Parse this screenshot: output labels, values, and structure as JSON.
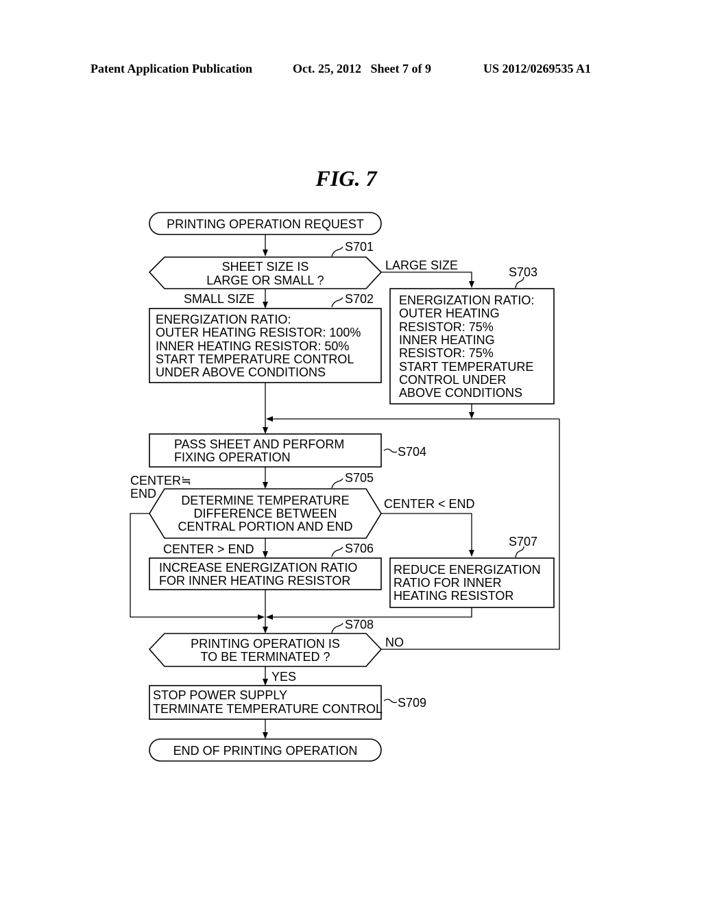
{
  "header": {
    "left": "Patent Application Publication",
    "middle": "Oct. 25, 2012   Sheet 7 of 9",
    "right": "US 2012/0269535 A1"
  },
  "figure_title": "FIG. 7",
  "nodes": {
    "start": {
      "lines": [
        "PRINTING OPERATION REQUEST"
      ]
    },
    "s701": {
      "step": "S701",
      "lines": [
        "SHEET SIZE IS",
        "LARGE OR SMALL ?"
      ]
    },
    "s702": {
      "step": "S702",
      "lines": [
        "ENERGIZATION RATIO:",
        "OUTER HEATING RESISTOR: 100%",
        "INNER HEATING RESISTOR: 50%",
        "START TEMPERATURE CONTROL",
        "UNDER ABOVE CONDITIONS"
      ]
    },
    "s703": {
      "step": "S703",
      "lines": [
        "ENERGIZATION RATIO:",
        "OUTER HEATING",
        "RESISTOR: 75%",
        "INNER HEATING",
        "RESISTOR: 75%",
        "START TEMPERATURE",
        "CONTROL UNDER",
        "ABOVE CONDITIONS"
      ]
    },
    "s704": {
      "step": "S704",
      "lines": [
        "PASS SHEET AND PERFORM",
        "FIXING OPERATION"
      ]
    },
    "s705": {
      "step": "S705",
      "lines": [
        "DETERMINE TEMPERATURE",
        "DIFFERENCE BETWEEN",
        "CENTRAL PORTION AND END"
      ]
    },
    "s706": {
      "step": "S706",
      "lines": [
        "INCREASE ENERGIZATION RATIO",
        "FOR INNER HEATING RESISTOR"
      ]
    },
    "s707": {
      "step": "S707",
      "lines": [
        "REDUCE ENERGIZATION",
        "RATIO FOR INNER",
        "HEATING RESISTOR"
      ]
    },
    "s708": {
      "step": "S708",
      "lines": [
        "PRINTING OPERATION IS",
        "TO BE TERMINATED ?"
      ]
    },
    "s709": {
      "step": "S709",
      "lines": [
        "STOP POWER SUPPLY",
        "TERMINATE TEMPERATURE CONTROL"
      ]
    },
    "end": {
      "lines": [
        "END OF PRINTING OPERATION"
      ]
    }
  },
  "edge_labels": {
    "large": "LARGE SIZE",
    "small": "SMALL SIZE",
    "approx1": "CENTER≒",
    "approx2": "END",
    "less": "CENTER < END",
    "greater": "CENTER > END",
    "no": "NO",
    "yes": "YES"
  }
}
